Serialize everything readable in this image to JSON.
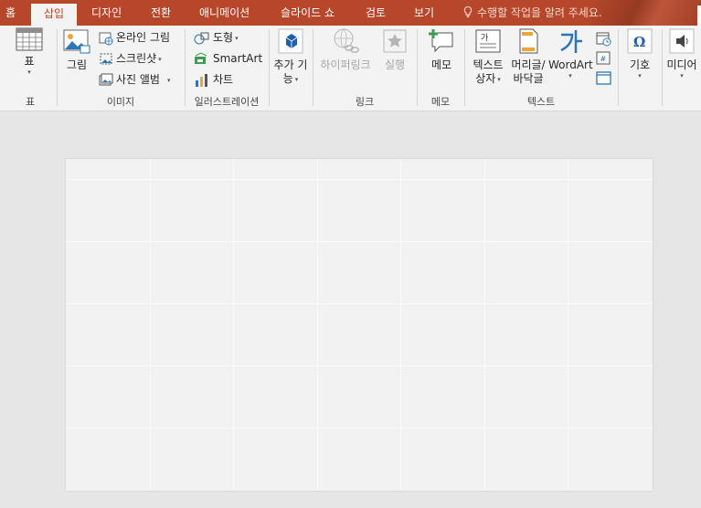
{
  "tabs": [
    {
      "label": "홈",
      "active": false
    },
    {
      "label": "삽입",
      "active": true
    },
    {
      "label": "디자인",
      "active": false
    },
    {
      "label": "전환",
      "active": false
    },
    {
      "label": "애니메이션",
      "active": false
    },
    {
      "label": "슬라이드 쇼",
      "active": false
    },
    {
      "label": "검토",
      "active": false
    },
    {
      "label": "보기",
      "active": false
    }
  ],
  "tell_me": "수행할 작업을 알려 주세요.",
  "groups": {
    "table": {
      "label": "표",
      "table_btn": "표"
    },
    "images": {
      "label": "이미지",
      "picture": "그림",
      "online_pictures": "온라인 그림",
      "screenshot": "스크린샷",
      "photo_album": "사진 앨범"
    },
    "illustrations": {
      "label": "일러스트레이션",
      "shapes": "도형",
      "smartart": "SmartArt",
      "chart": "차트"
    },
    "addins": {
      "label": "",
      "addins_btn_line1": "추가 기",
      "addins_btn_line2": "능"
    },
    "links": {
      "label": "링크",
      "hyperlink": "하이퍼링크",
      "action": "실행"
    },
    "comments": {
      "label": "메모",
      "comment": "메모"
    },
    "text": {
      "label": "텍스트",
      "textbox_line1": "텍스트",
      "textbox_line2": "상자",
      "header_line1": "머리글/",
      "header_line2": "바닥글",
      "wordart": "WordArt"
    },
    "symbols": {
      "symbol": "기호"
    },
    "media": {
      "media": "미디어"
    }
  },
  "colors": {
    "accent": "#b7472a",
    "ribbon_bg": "#f3f3f3",
    "workspace_bg": "#e6e6e6"
  }
}
